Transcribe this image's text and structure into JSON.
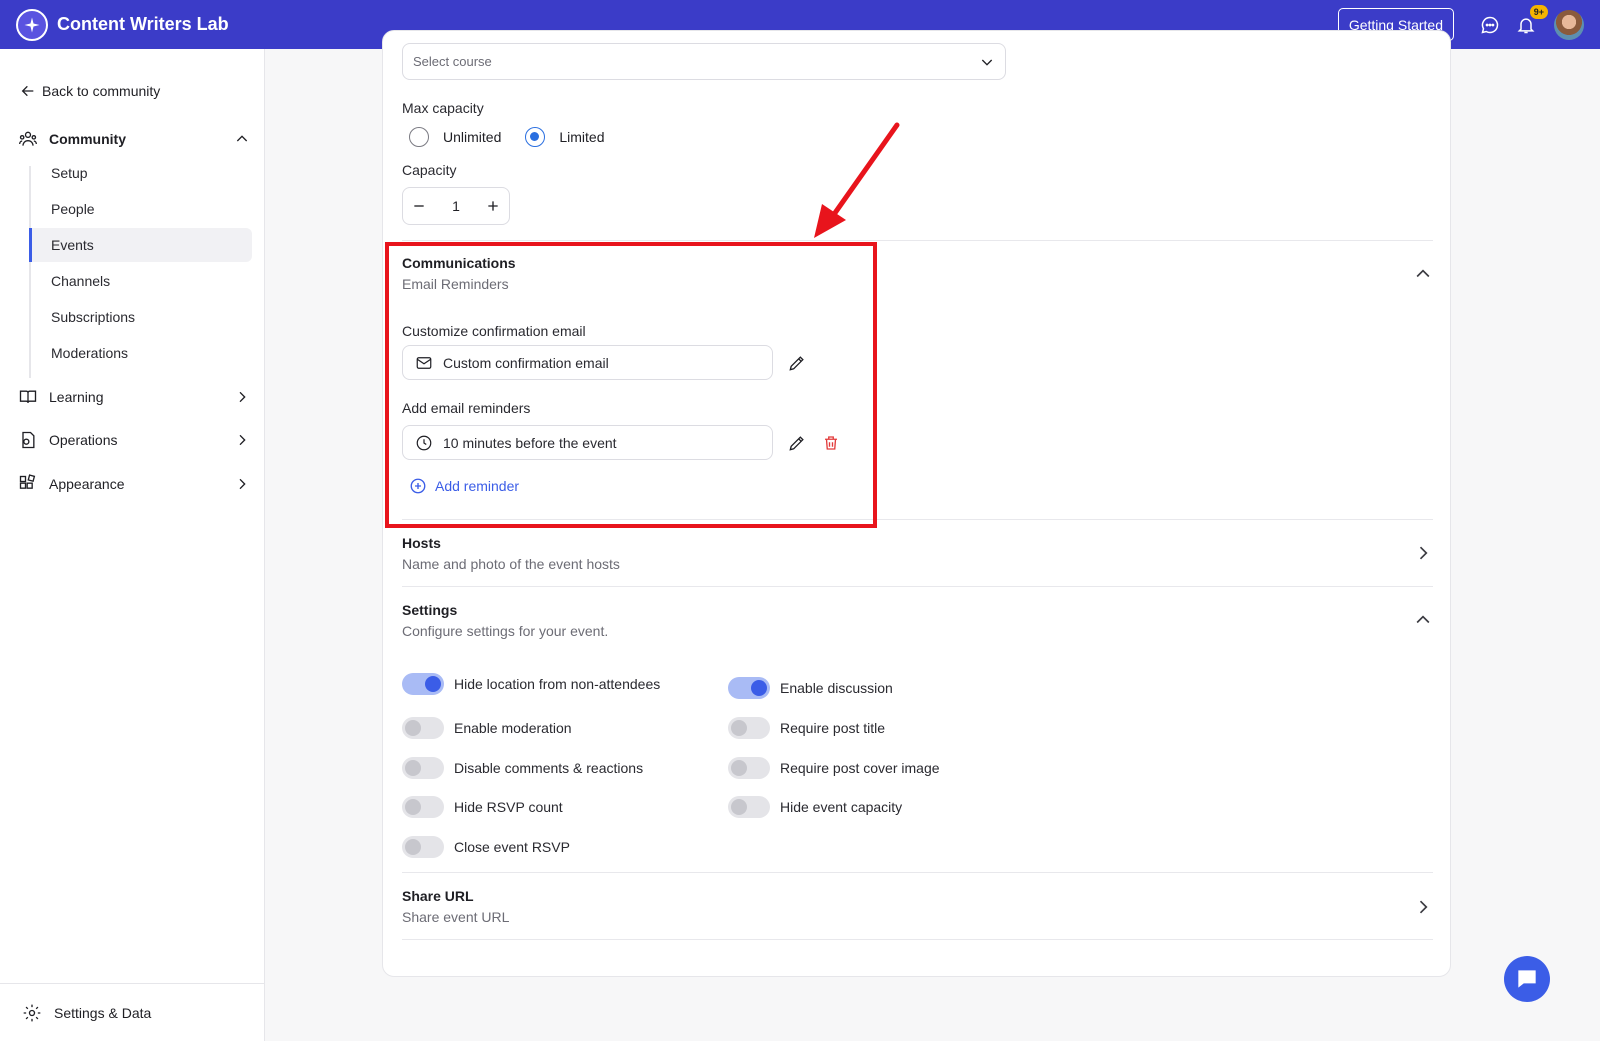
{
  "app": {
    "title": "Content Writers Lab"
  },
  "topbar": {
    "getting_started": "Getting Started",
    "notif_count": "9+"
  },
  "sidebar": {
    "back": "Back to community",
    "community": "Community",
    "community_items": [
      "Setup",
      "People",
      "Events",
      "Channels",
      "Subscriptions",
      "Moderations"
    ],
    "active_item": "Events",
    "learning": "Learning",
    "operations": "Operations",
    "appearance": "Appearance",
    "footer": "Settings & Data"
  },
  "form": {
    "course_placeholder": "Select course",
    "max_capacity_label": "Max capacity",
    "capacity_options": [
      "Unlimited",
      "Limited"
    ],
    "capacity_selected": "Limited",
    "capacity_label": "Capacity",
    "capacity_value": "1"
  },
  "communications": {
    "title": "Communications",
    "subtitle": "Email Reminders",
    "confirm_label": "Customize confirmation email",
    "confirm_value": "Custom confirmation email",
    "reminders_label": "Add email reminders",
    "reminder_value": "10 minutes before the event",
    "add_reminder": "Add reminder"
  },
  "hosts": {
    "title": "Hosts",
    "subtitle": "Name and photo of the event hosts"
  },
  "settings": {
    "title": "Settings",
    "subtitle": "Configure settings for your event.",
    "left": [
      {
        "label": "Hide location from non-attendees",
        "on": true
      },
      {
        "label": "Enable moderation",
        "on": false
      },
      {
        "label": "Disable comments & reactions",
        "on": false
      },
      {
        "label": "Hide RSVP count",
        "on": false
      },
      {
        "label": "Close event RSVP",
        "on": false
      }
    ],
    "right": [
      {
        "label": "Enable discussion",
        "on": true
      },
      {
        "label": "Require post title",
        "on": false
      },
      {
        "label": "Require post cover image",
        "on": false
      },
      {
        "label": "Hide event capacity",
        "on": false
      }
    ]
  },
  "share": {
    "title": "Share URL",
    "subtitle": "Share event URL"
  },
  "colors": {
    "topbar": "#3b3cc8",
    "accent": "#3b5de7",
    "annotation": "#e8141c"
  }
}
